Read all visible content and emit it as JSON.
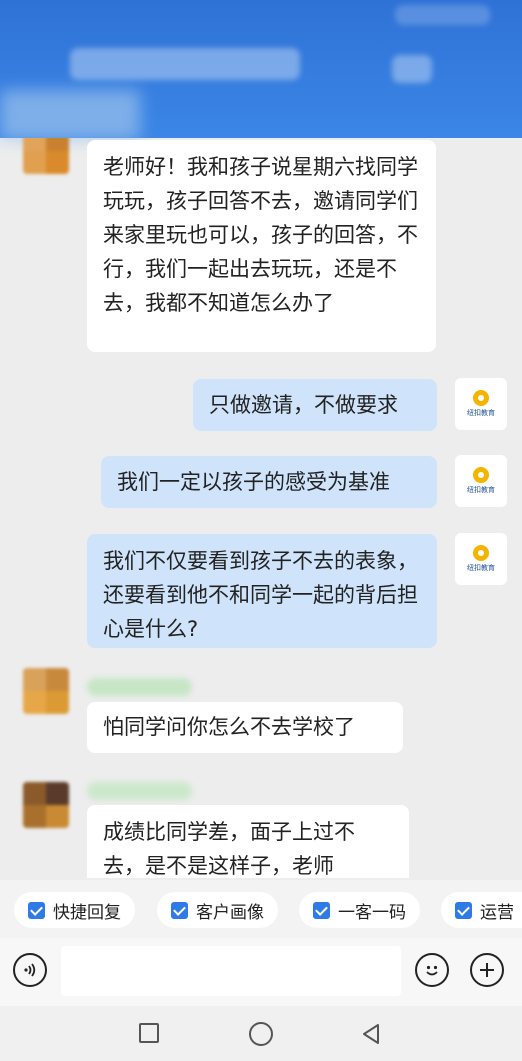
{
  "chat": {
    "messages": [
      {
        "side": "in",
        "text": "老师好！我和孩子说星期六找同学玩玩，孩子回答不去，邀请同学们来家里玩也可以，孩子的回答，不行，我们一起出去玩玩，还是不去，我都不知道怎么办了"
      },
      {
        "side": "out",
        "text": "只做邀请，不做要求",
        "avatar": "纽扣教育"
      },
      {
        "side": "out",
        "text": "我们一定以孩子的感受为基准",
        "avatar": "纽扣教育"
      },
      {
        "side": "out",
        "text": "我们不仅要看到孩子不去的表象，还要看到他不和同学一起的背后担心是什么?",
        "avatar": "纽扣教育"
      },
      {
        "side": "in",
        "text": "怕同学问你怎么不去学校了"
      },
      {
        "side": "in",
        "text": "成绩比同学差，面子上过不去，是不是这样子，老师"
      }
    ]
  },
  "quick_actions": [
    "快捷回复",
    "客户画像",
    "一客一码",
    "运营"
  ],
  "icons": {
    "voice": "voice-icon",
    "emoji": "emoji-icon",
    "add": "plus-icon",
    "nav_square": "recent-apps-icon",
    "nav_circle": "home-icon",
    "nav_triangle": "back-icon"
  },
  "colors": {
    "header": "#2f72d6",
    "bubble_out": "#cfe4fb",
    "bubble_in": "#ffffff",
    "check": "#2f7be5"
  }
}
